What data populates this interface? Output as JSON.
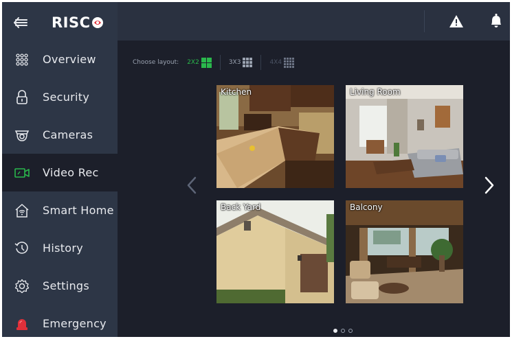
{
  "brand": {
    "logo_text": "RISC"
  },
  "sidebar": {
    "items": [
      {
        "label": "Overview",
        "icon": "grid-dots-icon",
        "active": false
      },
      {
        "label": "Security",
        "icon": "lock-icon",
        "active": false
      },
      {
        "label": "Cameras",
        "icon": "camera-icon",
        "active": false
      },
      {
        "label": "Video Rec",
        "icon": "video-rec-icon",
        "active": true
      },
      {
        "label": "Smart Home",
        "icon": "smart-home-icon",
        "active": false
      },
      {
        "label": "History",
        "icon": "history-icon",
        "active": false
      },
      {
        "label": "Settings",
        "icon": "gear-icon",
        "active": false
      },
      {
        "label": "Emergency",
        "icon": "emergency-icon",
        "active": false
      }
    ]
  },
  "layout": {
    "label": "Choose layout:",
    "options": [
      {
        "text": "2X2",
        "state": "selected"
      },
      {
        "text": "3X3",
        "state": "normal"
      },
      {
        "text": "4X4",
        "state": "disabled"
      }
    ]
  },
  "cameras": [
    {
      "name": "Kitchen"
    },
    {
      "name": "Living Room"
    },
    {
      "name": "Back Yard"
    },
    {
      "name": "Balcony"
    }
  ],
  "pagination": {
    "pages": 3,
    "current": 1
  },
  "colors": {
    "accent": "#2ab84c",
    "sidebar_bg": "#2d3646",
    "content_bg": "#1c1f2a",
    "active_icon": "#2ab84c",
    "emergency": "#e0303a"
  }
}
